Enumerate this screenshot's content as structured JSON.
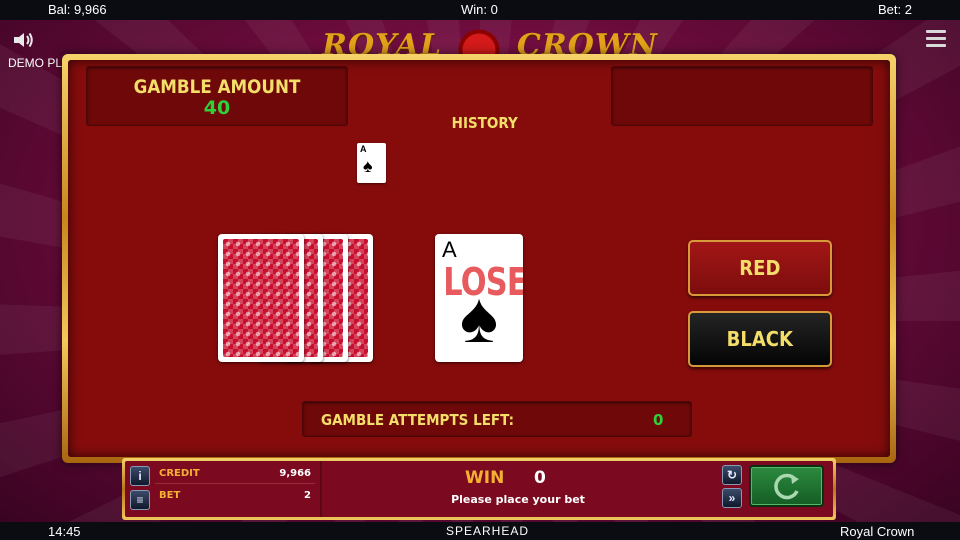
{
  "topbar": {
    "balance": "Bal: 9,966",
    "win": "Win: 0",
    "bet": "Bet: 2"
  },
  "header": {
    "demo_label": "DEMO PLAY",
    "logo_text_left": "ROYAL",
    "logo_text_right": "CROWN"
  },
  "gamble": {
    "amount_label": "GAMBLE AMOUNT",
    "amount_value": "40",
    "history_label": "HISTORY",
    "history_cards": [
      {
        "rank": "A",
        "suit": "♠"
      }
    ],
    "current_card": {
      "rank": "A",
      "suit": "♠"
    },
    "result_text": "LOSE",
    "attempts_label": "GAMBLE ATTEMPTS LEFT:",
    "attempts_value": "0"
  },
  "buttons": {
    "red": "RED",
    "black": "BLACK"
  },
  "bottom_panel": {
    "credit_label": "CREDIT",
    "credit_value": "9,966",
    "bet_label": "BET",
    "bet_value": "2",
    "win_label": "WIN",
    "win_value": "0",
    "message": "Please place your bet"
  },
  "footer": {
    "time": "14:45",
    "provider": "SPEARHEAD",
    "game_name": "Royal Crown"
  },
  "colors": {
    "accent_yellow": "#f4de6a",
    "value_green": "#2fd13a",
    "panel_red": "#860c0c",
    "gold": "#c8871d"
  },
  "icons": [
    "speaker-icon",
    "menu-icon",
    "info-icon",
    "coins-icon",
    "autoplay-icon",
    "fast-forward-icon",
    "spin-icon"
  ]
}
